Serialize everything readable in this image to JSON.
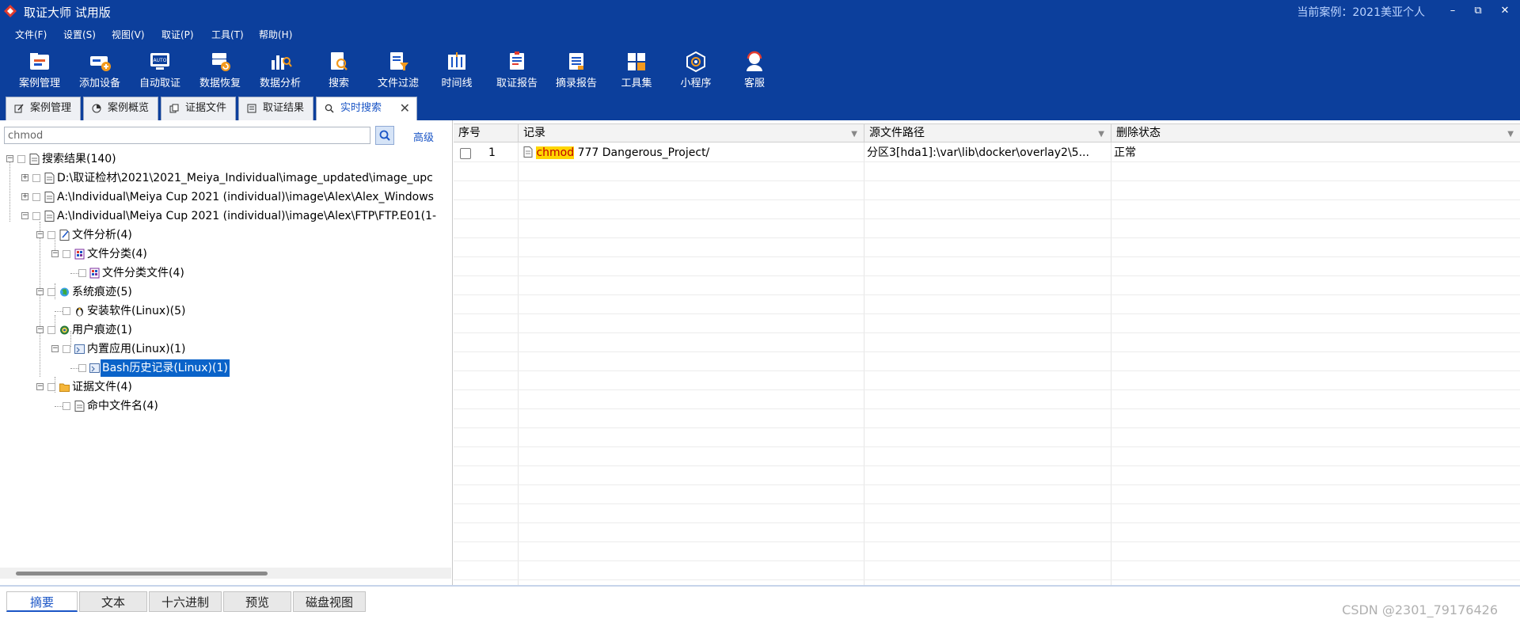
{
  "titlebar": {
    "app_title": "取证大师 试用版",
    "current_case": "当前案例：2021美亚个人",
    "minimize": "–",
    "maximize": "⧉",
    "close": "✕"
  },
  "menu": [
    "文件(F)",
    "设置(S)",
    "视图(V)",
    "取证(P)",
    "工具(T)",
    "帮助(H)"
  ],
  "toolbar": [
    {
      "label": "案例管理",
      "icon": "case-management-icon"
    },
    {
      "label": "添加设备",
      "icon": "add-device-icon"
    },
    {
      "label": "自动取证",
      "icon": "auto-forensics-icon"
    },
    {
      "label": "数据恢复",
      "icon": "data-recovery-icon"
    },
    {
      "label": "数据分析",
      "icon": "data-analysis-icon"
    },
    {
      "label": "搜索",
      "icon": "search-icon"
    },
    {
      "label": "文件过滤",
      "icon": "file-filter-icon"
    },
    {
      "label": "时间线",
      "icon": "timeline-icon"
    },
    {
      "label": "取证报告",
      "icon": "forensic-report-icon"
    },
    {
      "label": "摘录报告",
      "icon": "excerpt-report-icon"
    },
    {
      "label": "工具集",
      "icon": "toolset-icon"
    },
    {
      "label": "小程序",
      "icon": "mini-program-icon"
    },
    {
      "label": "客服",
      "icon": "customer-service-icon"
    }
  ],
  "doc_tabs": [
    {
      "label": "案例管理",
      "active": false
    },
    {
      "label": "案例概览",
      "active": false
    },
    {
      "label": "证据文件",
      "active": false
    },
    {
      "label": "取证结果",
      "active": false
    },
    {
      "label": "实时搜索",
      "active": true,
      "close": "✕"
    }
  ],
  "search": {
    "value": "chmod",
    "advanced": "高级"
  },
  "tree": [
    {
      "label": "搜索结果(140)"
    },
    {
      "label": "D:\\取证检材\\2021\\2021_Meiya_Individual\\image_updated\\image_upc"
    },
    {
      "label": "A:\\Individual\\Meiya Cup 2021 (individual)\\image\\Alex\\Alex_Windows"
    },
    {
      "label": "A:\\Individual\\Meiya Cup 2021 (individual)\\image\\Alex\\FTP\\FTP.E01(1-"
    },
    {
      "label": "文件分析(4)"
    },
    {
      "label": "文件分类(4)"
    },
    {
      "label": "文件分类文件(4)"
    },
    {
      "label": "系统痕迹(5)"
    },
    {
      "label": "安装软件(Linux)(5)"
    },
    {
      "label": "用户痕迹(1)"
    },
    {
      "label": "内置应用(Linux)(1)"
    },
    {
      "label": "Bash历史记录(Linux)(1)"
    },
    {
      "label": "证据文件(4)"
    },
    {
      "label": "命中文件名(4)"
    }
  ],
  "grid": {
    "columns": [
      "序号",
      "记录",
      "源文件路径",
      "删除状态"
    ],
    "filter_glyph": "▼",
    "rows": [
      {
        "index": "1",
        "record_highlight": "chmod",
        "record_rest": " 777 Dangerous_Project/",
        "source_path": "分区3[hda1]:\\var\\lib\\docker\\overlay2\\5...",
        "delete_status": "正常"
      }
    ]
  },
  "bottom_tabs": [
    {
      "label": "摘要",
      "active": true
    },
    {
      "label": "文本",
      "active": false
    },
    {
      "label": "十六进制",
      "active": false
    },
    {
      "label": "预览",
      "active": false
    },
    {
      "label": "磁盘视图",
      "active": false
    }
  ],
  "watermark": "CSDN @2301_79176426",
  "colors": {
    "chrome": "#0c3f9c",
    "selection": "#0a63c9",
    "highlight": "#ffd500",
    "link": "#1a55c6"
  }
}
